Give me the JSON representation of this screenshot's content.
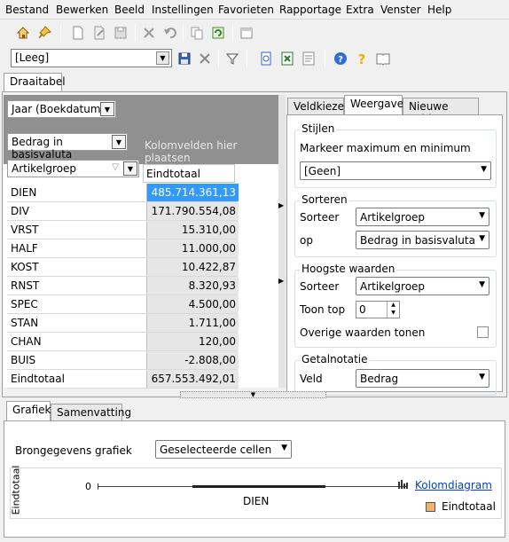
{
  "menu": [
    "Bestand",
    "Bewerken",
    "Beeld",
    "Instellingen",
    "Favorieten",
    "Rapportage",
    "Extra",
    "Venster",
    "Help"
  ],
  "toolbar2": {
    "combo_value": "[Leeg]"
  },
  "main_tab": "Draaitabel",
  "pivot": {
    "filter_field": "Jaar (Boekdatum)",
    "data_field": "Bedrag in basisvaluta",
    "column_placeholder": "Kolomvelden hier plaatsen",
    "row_field": "Artikelgroep",
    "total_header": "Eindtotaal",
    "rows": [
      {
        "label": "DIEN",
        "value": "485.714.361,13"
      },
      {
        "label": "DIV",
        "value": "171.790.554,08"
      },
      {
        "label": "VRST",
        "value": "15.310,00"
      },
      {
        "label": "HALF",
        "value": "11.000,00"
      },
      {
        "label": "KOST",
        "value": "10.422,87"
      },
      {
        "label": "RNST",
        "value": "8.320,93"
      },
      {
        "label": "SPEC",
        "value": "4.500,00"
      },
      {
        "label": "STAN",
        "value": "1.711,00"
      },
      {
        "label": "CHAN",
        "value": "120,00"
      },
      {
        "label": "BUIS",
        "value": "-2.808,00"
      },
      {
        "label": "Eindtotaal",
        "value": "657.553.492,01"
      }
    ]
  },
  "right_tabs": [
    "Veldkiezer",
    "Weergave",
    "Nieuwe velden"
  ],
  "stijlen": {
    "title": "Stijlen",
    "label": "Markeer maximum en minimum",
    "value": "[Geen]"
  },
  "sorteren": {
    "title": "Sorteren",
    "sorteer_label": "Sorteer",
    "sorteer_value": "Artikelgroep",
    "op_label": "op",
    "op_value": "Bedrag in basisvaluta"
  },
  "hoogste": {
    "title": "Hoogste waarden",
    "sorteer_label": "Sorteer",
    "sorteer_value": "Artikelgroep",
    "toon_label": "Toon top",
    "toon_value": "0",
    "overige_label": "Overige waarden tonen"
  },
  "getal": {
    "title": "Getalnotatie",
    "veld_label": "Veld",
    "veld_value": "Bedrag"
  },
  "bottom_tabs": [
    "Grafiek",
    "Samenvatting"
  ],
  "grafiek": {
    "source_label": "Brongegevens grafiek",
    "source_value": "Geselecteerde cellen",
    "y_axis_label": "Eindtotaal",
    "y_tick": "0",
    "x_tick": "DIEN",
    "chart_type_link": "Kolomdiagram",
    "legend": "Eindtotaal",
    "legend_color": "#f5b36a"
  }
}
